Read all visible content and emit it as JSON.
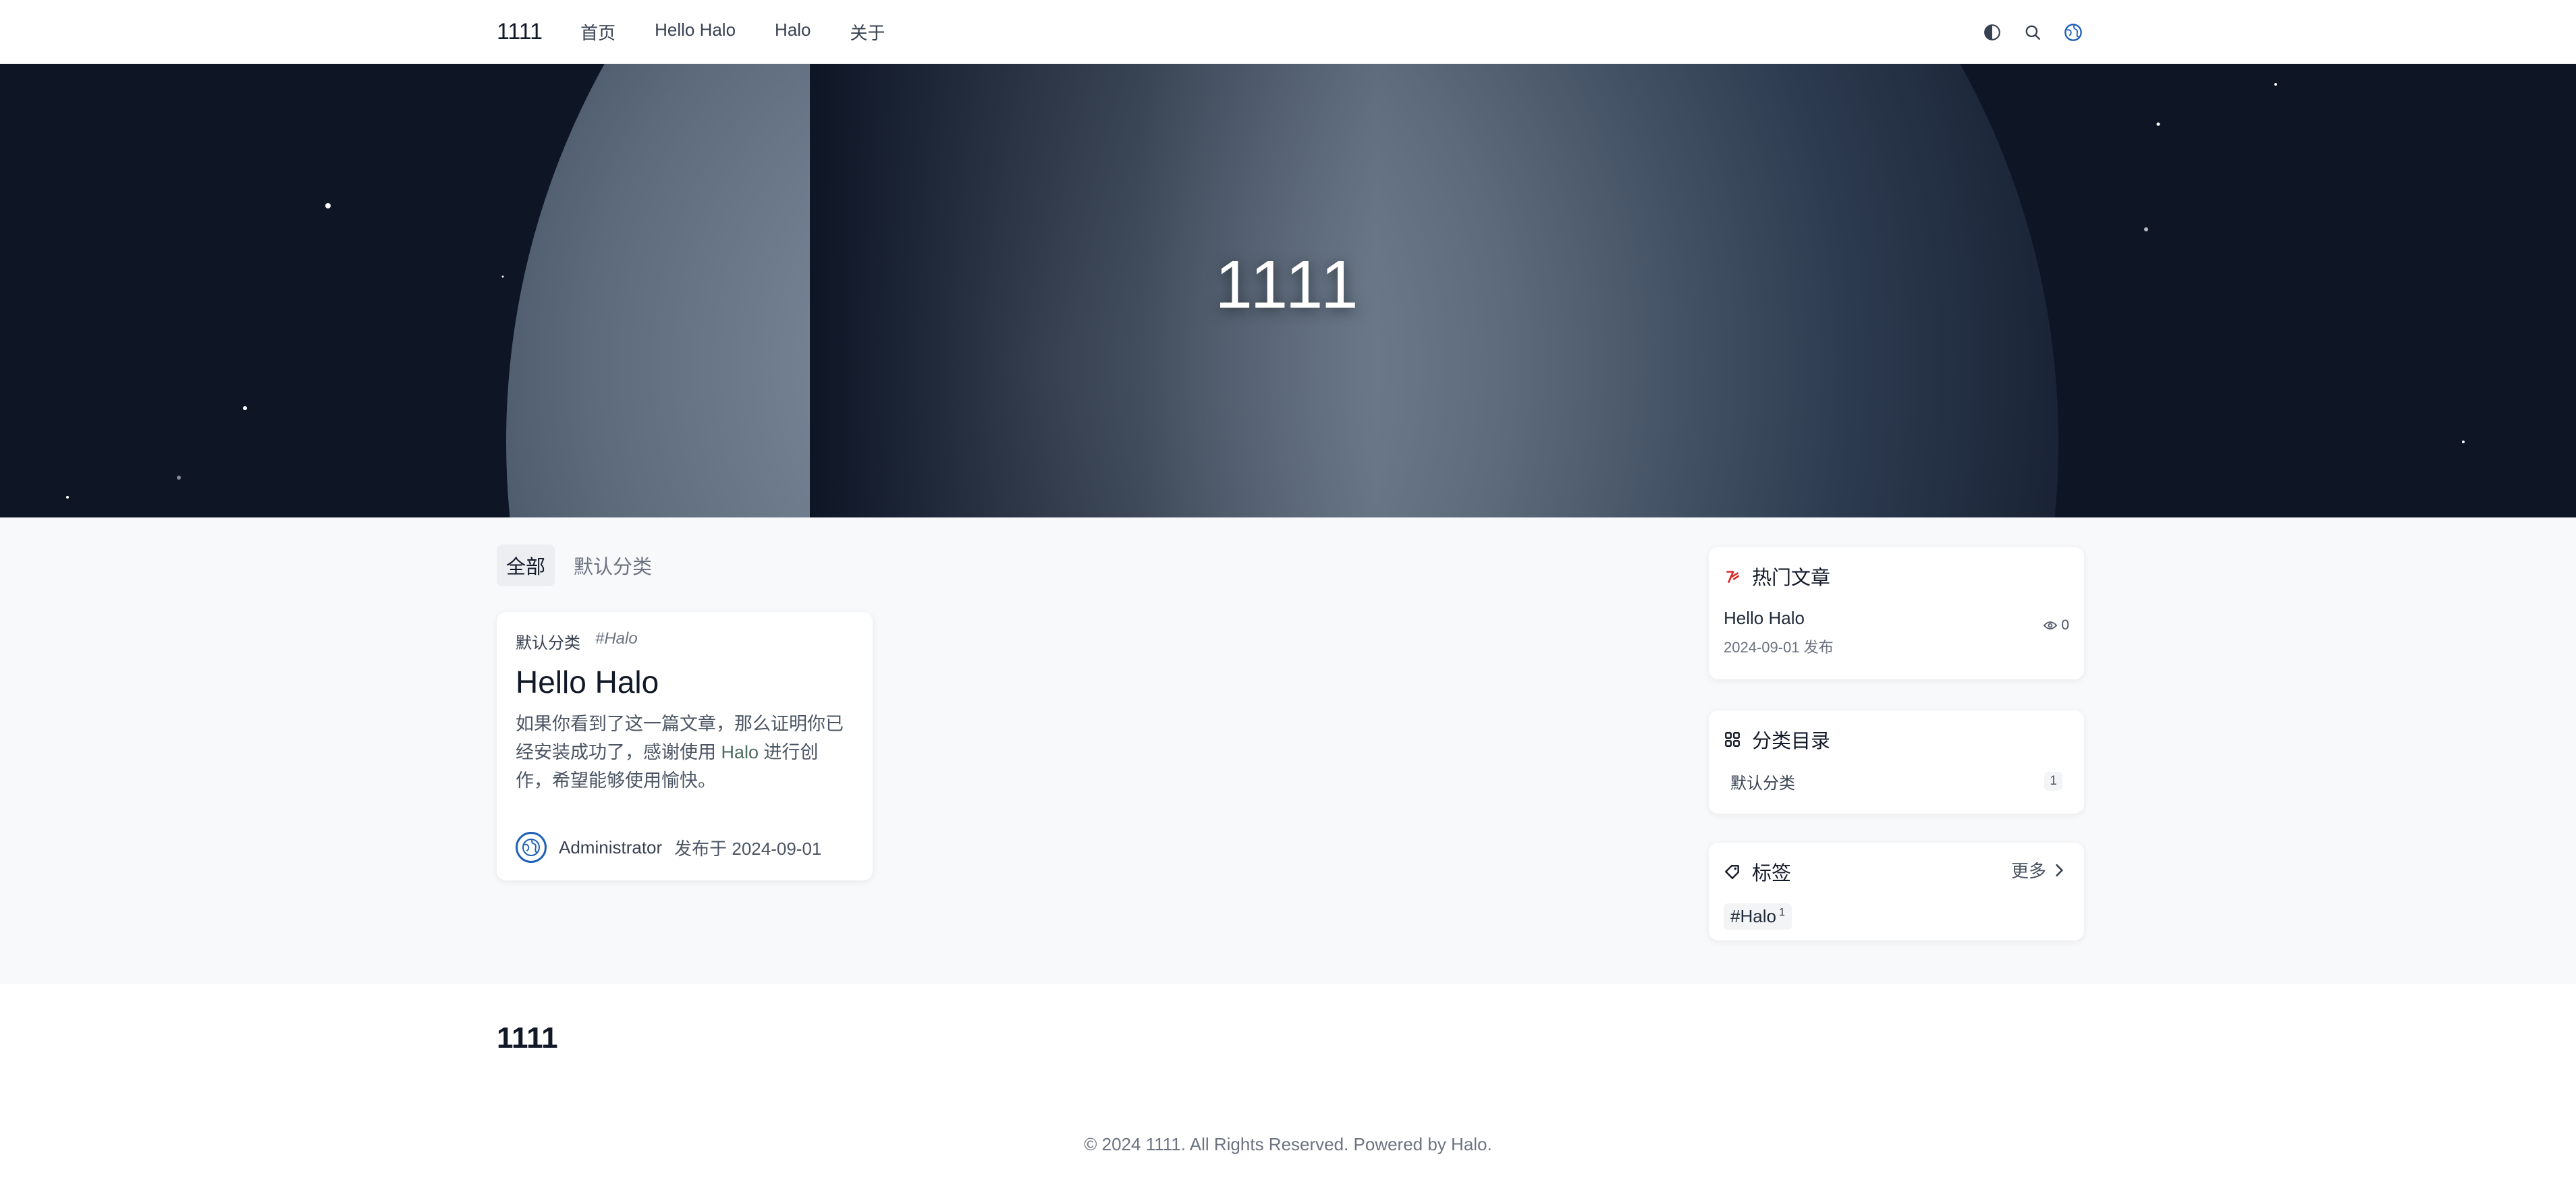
{
  "header": {
    "brand": "1111",
    "nav": [
      "首页",
      "Hello Halo",
      "Halo",
      "关于"
    ],
    "icons": [
      "theme-toggle-icon",
      "search-icon",
      "globe-icon"
    ]
  },
  "hero": {
    "title": "1111"
  },
  "tabs": [
    {
      "label": "全部",
      "active": true
    },
    {
      "label": "默认分类",
      "active": false
    }
  ],
  "post": {
    "category": "默认分类",
    "tag": "#Halo",
    "title": "Hello Halo",
    "excerpt_before": "如果你看到了这一篇文章，那么证明你已经安装成功了，感谢使用 ",
    "excerpt_link": "Halo",
    "excerpt_after": " 进行创作，希望能够使用愉快。",
    "author": "Administrator",
    "date": "发布于 2024-09-01"
  },
  "sidebar": {
    "hot": {
      "title": "热门文章",
      "items": [
        {
          "title": "Hello Halo",
          "date": "2024-09-01 发布",
          "views": "0"
        }
      ]
    },
    "categories": {
      "title": "分类目录",
      "items": [
        {
          "name": "默认分类",
          "count": "1"
        }
      ]
    },
    "tags": {
      "title": "标签",
      "more": "更多",
      "items": [
        {
          "name": "#Halo",
          "count": "1"
        }
      ]
    }
  },
  "footer": {
    "brand": "1111",
    "copyright": "© 2024 1111. All Rights Reserved. Powered by Halo."
  },
  "colors": {
    "accent": "#1e5fb8",
    "hot_icon": "#dc2626",
    "hero_bg": "#0e1626",
    "main_bg": "#f8f9fb"
  }
}
